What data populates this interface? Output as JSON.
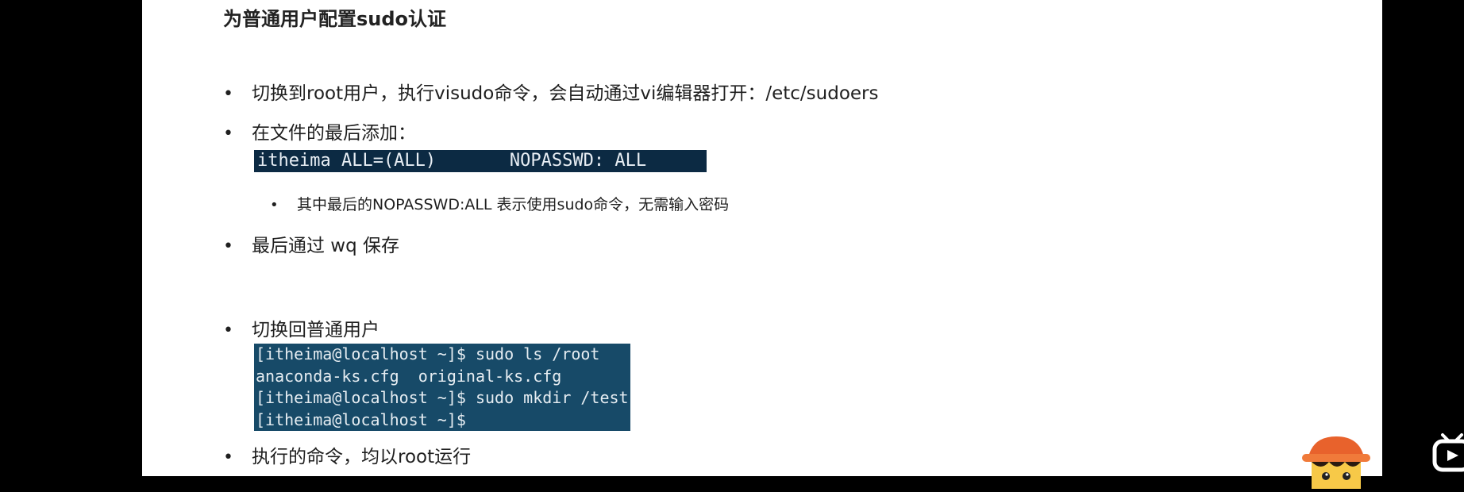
{
  "slide": {
    "title": "为普通用户配置sudo认证",
    "bullets": [
      "切换到root用户，执行visudo命令，会自动通过vi编辑器打开：/etc/sudoers",
      "在文件的最后添加：",
      "最后通过 wq 保存",
      "切换回普通用户",
      "执行的命令，均以root运行"
    ],
    "sub_bullet": "其中最后的NOPASSWD:ALL 表示使用sudo命令，无需输入密码",
    "sudoers_line": "itheima ALL=(ALL)       NOPASSWD: ALL",
    "terminal_lines": [
      "[itheima@localhost ~]$ sudo ls /root",
      "anaconda-ks.cfg  original-ks.cfg",
      "[itheima@localhost ~]$ sudo mkdir /test",
      "[itheima@localhost ~]$"
    ],
    "bullet_glyph": "•"
  },
  "overlay": {
    "mascot_icon": "cartoon-avatar-icon",
    "player_icon": "play-icon"
  },
  "colors": {
    "code_bg": "#0c2a43",
    "terminal_bg": "#174a68",
    "page_bg": "#000000",
    "slide_bg": "#ffffff"
  }
}
